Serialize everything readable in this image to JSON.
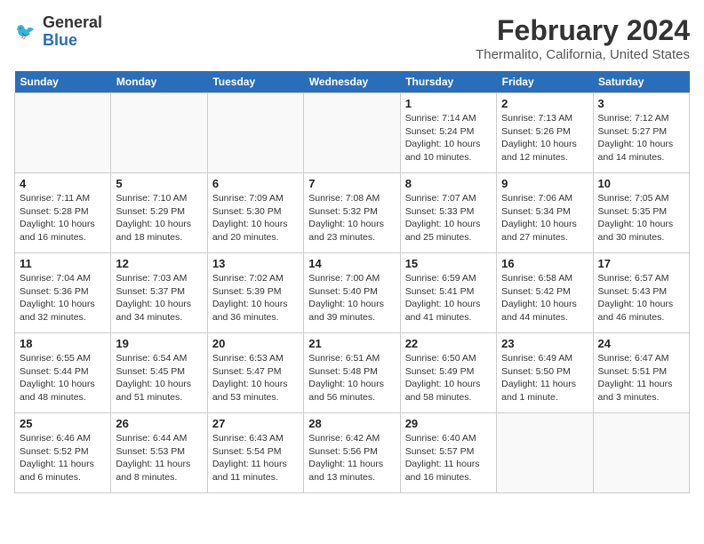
{
  "header": {
    "logo_line1": "General",
    "logo_line2": "Blue",
    "title": "February 2024",
    "subtitle": "Thermalito, California, United States"
  },
  "days_of_week": [
    "Sunday",
    "Monday",
    "Tuesday",
    "Wednesday",
    "Thursday",
    "Friday",
    "Saturday"
  ],
  "weeks": [
    [
      {
        "date": "",
        "content": ""
      },
      {
        "date": "",
        "content": ""
      },
      {
        "date": "",
        "content": ""
      },
      {
        "date": "",
        "content": ""
      },
      {
        "date": "1",
        "content": "Sunrise: 7:14 AM\nSunset: 5:24 PM\nDaylight: 10 hours\nand 10 minutes."
      },
      {
        "date": "2",
        "content": "Sunrise: 7:13 AM\nSunset: 5:26 PM\nDaylight: 10 hours\nand 12 minutes."
      },
      {
        "date": "3",
        "content": "Sunrise: 7:12 AM\nSunset: 5:27 PM\nDaylight: 10 hours\nand 14 minutes."
      }
    ],
    [
      {
        "date": "4",
        "content": "Sunrise: 7:11 AM\nSunset: 5:28 PM\nDaylight: 10 hours\nand 16 minutes."
      },
      {
        "date": "5",
        "content": "Sunrise: 7:10 AM\nSunset: 5:29 PM\nDaylight: 10 hours\nand 18 minutes."
      },
      {
        "date": "6",
        "content": "Sunrise: 7:09 AM\nSunset: 5:30 PM\nDaylight: 10 hours\nand 20 minutes."
      },
      {
        "date": "7",
        "content": "Sunrise: 7:08 AM\nSunset: 5:32 PM\nDaylight: 10 hours\nand 23 minutes."
      },
      {
        "date": "8",
        "content": "Sunrise: 7:07 AM\nSunset: 5:33 PM\nDaylight: 10 hours\nand 25 minutes."
      },
      {
        "date": "9",
        "content": "Sunrise: 7:06 AM\nSunset: 5:34 PM\nDaylight: 10 hours\nand 27 minutes."
      },
      {
        "date": "10",
        "content": "Sunrise: 7:05 AM\nSunset: 5:35 PM\nDaylight: 10 hours\nand 30 minutes."
      }
    ],
    [
      {
        "date": "11",
        "content": "Sunrise: 7:04 AM\nSunset: 5:36 PM\nDaylight: 10 hours\nand 32 minutes."
      },
      {
        "date": "12",
        "content": "Sunrise: 7:03 AM\nSunset: 5:37 PM\nDaylight: 10 hours\nand 34 minutes."
      },
      {
        "date": "13",
        "content": "Sunrise: 7:02 AM\nSunset: 5:39 PM\nDaylight: 10 hours\nand 36 minutes."
      },
      {
        "date": "14",
        "content": "Sunrise: 7:00 AM\nSunset: 5:40 PM\nDaylight: 10 hours\nand 39 minutes."
      },
      {
        "date": "15",
        "content": "Sunrise: 6:59 AM\nSunset: 5:41 PM\nDaylight: 10 hours\nand 41 minutes."
      },
      {
        "date": "16",
        "content": "Sunrise: 6:58 AM\nSunset: 5:42 PM\nDaylight: 10 hours\nand 44 minutes."
      },
      {
        "date": "17",
        "content": "Sunrise: 6:57 AM\nSunset: 5:43 PM\nDaylight: 10 hours\nand 46 minutes."
      }
    ],
    [
      {
        "date": "18",
        "content": "Sunrise: 6:55 AM\nSunset: 5:44 PM\nDaylight: 10 hours\nand 48 minutes."
      },
      {
        "date": "19",
        "content": "Sunrise: 6:54 AM\nSunset: 5:45 PM\nDaylight: 10 hours\nand 51 minutes."
      },
      {
        "date": "20",
        "content": "Sunrise: 6:53 AM\nSunset: 5:47 PM\nDaylight: 10 hours\nand 53 minutes."
      },
      {
        "date": "21",
        "content": "Sunrise: 6:51 AM\nSunset: 5:48 PM\nDaylight: 10 hours\nand 56 minutes."
      },
      {
        "date": "22",
        "content": "Sunrise: 6:50 AM\nSunset: 5:49 PM\nDaylight: 10 hours\nand 58 minutes."
      },
      {
        "date": "23",
        "content": "Sunrise: 6:49 AM\nSunset: 5:50 PM\nDaylight: 11 hours\nand 1 minute."
      },
      {
        "date": "24",
        "content": "Sunrise: 6:47 AM\nSunset: 5:51 PM\nDaylight: 11 hours\nand 3 minutes."
      }
    ],
    [
      {
        "date": "25",
        "content": "Sunrise: 6:46 AM\nSunset: 5:52 PM\nDaylight: 11 hours\nand 6 minutes."
      },
      {
        "date": "26",
        "content": "Sunrise: 6:44 AM\nSunset: 5:53 PM\nDaylight: 11 hours\nand 8 minutes."
      },
      {
        "date": "27",
        "content": "Sunrise: 6:43 AM\nSunset: 5:54 PM\nDaylight: 11 hours\nand 11 minutes."
      },
      {
        "date": "28",
        "content": "Sunrise: 6:42 AM\nSunset: 5:56 PM\nDaylight: 11 hours\nand 13 minutes."
      },
      {
        "date": "29",
        "content": "Sunrise: 6:40 AM\nSunset: 5:57 PM\nDaylight: 11 hours\nand 16 minutes."
      },
      {
        "date": "",
        "content": ""
      },
      {
        "date": "",
        "content": ""
      }
    ]
  ]
}
